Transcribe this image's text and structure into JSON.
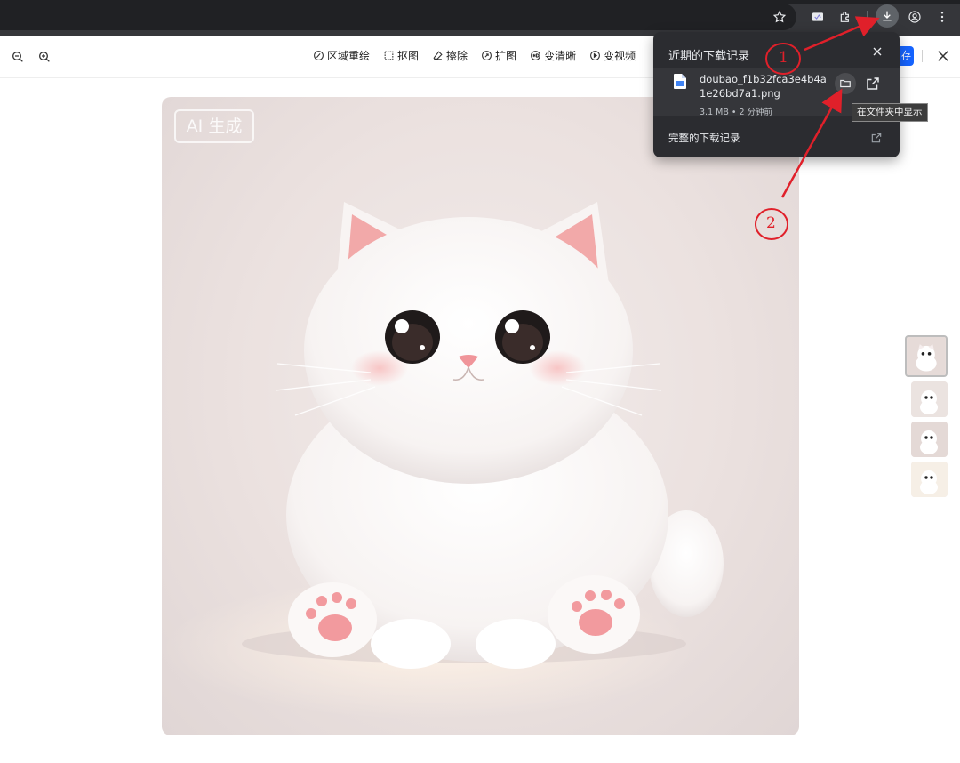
{
  "browser": {
    "icons": [
      "star-icon",
      "extension-app-icon",
      "puzzle-icon",
      "download-icon",
      "profile-icon",
      "more-vert-icon"
    ]
  },
  "toolbar": {
    "zoom_icons": [
      "zoom-out-icon",
      "zoom-in-icon"
    ],
    "tools": [
      {
        "label": "区域重绘",
        "icon": "brush-icon"
      },
      {
        "label": "抠图",
        "icon": "cutout-icon"
      },
      {
        "label": "擦除",
        "icon": "eraser-icon"
      },
      {
        "label": "扩图",
        "icon": "expand-icon"
      },
      {
        "label": "变清晰",
        "icon": "hd-icon"
      },
      {
        "label": "变视频",
        "icon": "video-icon"
      }
    ],
    "save_label_partial": "存"
  },
  "image": {
    "watermark": "AI 生成"
  },
  "thumbnails": {
    "count": 4,
    "active_index": 0
  },
  "downloads_panel": {
    "title": "近期的下载记录",
    "file": {
      "name": "doubao_f1b32fca3e4b4a1e26bd7a1.png",
      "size": "3.1 MB",
      "time": "2 分钟前",
      "meta": "3.1 MB • 2 分钟前"
    },
    "tooltip": "在文件夹中显示",
    "full_history_label": "完整的下载记录"
  },
  "annotations": {
    "labels": [
      "1",
      "2"
    ],
    "color": "#e0202a"
  },
  "colors": {
    "browser_bg": "#35363a",
    "panel_bg": "#2b2c30",
    "accent": "#1664ff"
  }
}
